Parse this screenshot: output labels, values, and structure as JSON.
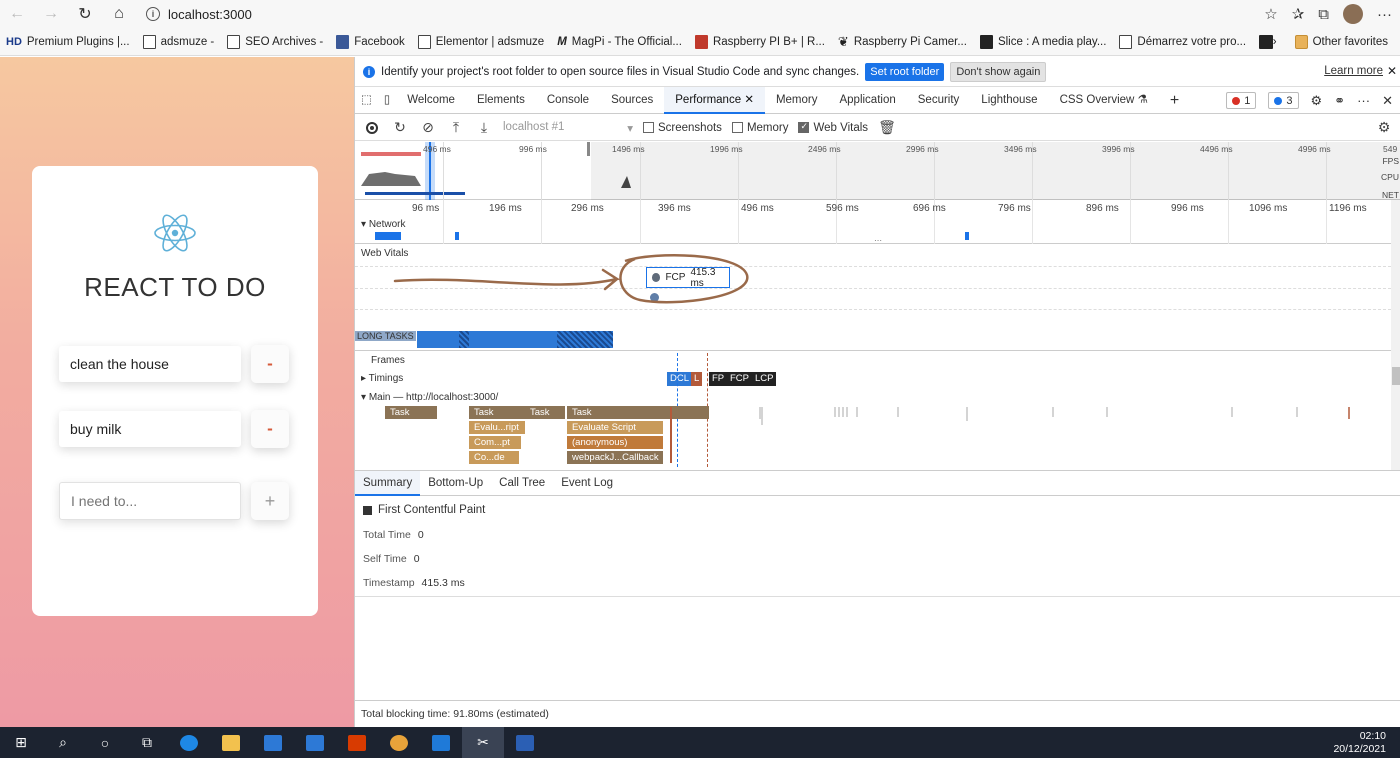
{
  "browser": {
    "url": "localhost:3000",
    "bookmarks": [
      {
        "label": "Premium Plugins |...",
        "icon": "hd-icon"
      },
      {
        "label": "adsmuze -",
        "icon": "page-icon"
      },
      {
        "label": "SEO Archives -",
        "icon": "page-icon"
      },
      {
        "label": "Facebook",
        "icon": "facebook-icon"
      },
      {
        "label": "Elementor | adsmuze",
        "icon": "page-icon"
      },
      {
        "label": "MagPi - The Official...",
        "icon": "magpi-icon"
      },
      {
        "label": "Raspberry PI B+ | R...",
        "icon": "raspberry-icon"
      },
      {
        "label": "Raspberry Pi Camer...",
        "icon": "raspberry-icon"
      },
      {
        "label": "Slice : A media play...",
        "icon": "slice-icon"
      },
      {
        "label": "Démarrez votre pro...",
        "icon": "page-icon"
      }
    ],
    "other_favorites": "Other favorites"
  },
  "app": {
    "title": "REACT TO DO",
    "todos": [
      "clean the house",
      "buy milk"
    ],
    "remove_label": "-",
    "input_placeholder": "I need to...",
    "add_label": "+"
  },
  "devtools": {
    "infobar": {
      "message": "Identify your project's root folder to open source files in Visual Studio Code and sync changes.",
      "set_root": "Set root folder",
      "dont_show": "Don't show again",
      "learn_more": "Learn more"
    },
    "tabs": [
      "Welcome",
      "Elements",
      "Console",
      "Sources",
      "Performance",
      "Memory",
      "Application",
      "Security",
      "Lighthouse",
      "CSS Overview"
    ],
    "active_tab": "Performance",
    "errors_count": "1",
    "messages_count": "3",
    "toolbar": {
      "target": "localhost #1",
      "screenshots": "Screenshots",
      "memory": "Memory",
      "web_vitals": "Web Vitals"
    },
    "overview": {
      "ticks": [
        "496 ms",
        "996 ms",
        "1496 ms",
        "1996 ms",
        "2496 ms",
        "2996 ms",
        "3496 ms",
        "3996 ms",
        "4496 ms",
        "4996 ms",
        "549"
      ],
      "labels": [
        "FPS",
        "CPU",
        "NET"
      ]
    },
    "ruler_ticks": [
      "96 ms",
      "196 ms",
      "296 ms",
      "396 ms",
      "496 ms",
      "596 ms",
      "696 ms",
      "796 ms",
      "896 ms",
      "996 ms",
      "1096 ms",
      "1196 ms"
    ],
    "network_label": "Network",
    "web_vitals_label": "Web Vitals",
    "fcp_label": "FCP",
    "fcp_value": "415.3 ms",
    "long_tasks_label": "LONG TASKS",
    "frames_label": "Frames",
    "timings_label": "Timings",
    "timings": [
      "DCL",
      "L",
      "FP",
      "FCP",
      "LCP"
    ],
    "main_label": "Main — http://localhost:3000/",
    "flame": {
      "tasks": [
        "Task",
        "Task",
        "Task",
        "Task"
      ],
      "row2": [
        "Evalu...ript",
        "Evaluate Script"
      ],
      "row3": [
        "Com...pt",
        "(anonymous)"
      ],
      "row4": [
        "Co...de",
        "webpackJ...Callback"
      ]
    },
    "subtabs": [
      "Summary",
      "Bottom-Up",
      "Call Tree",
      "Event Log"
    ],
    "summary": {
      "title": "First Contentful Paint",
      "total_time_label": "Total Time",
      "total_time": "0",
      "self_time_label": "Self Time",
      "self_time": "0",
      "timestamp_label": "Timestamp",
      "timestamp": "415.3 ms"
    },
    "footer": "Total blocking time: 91.80ms (estimated)"
  },
  "taskbar": {
    "time": "02:10",
    "date": "20/12/2021"
  },
  "colors": {
    "accent": "#1a73e8",
    "task_brown": "#8b7355",
    "annotation": "#9a6a4a"
  }
}
